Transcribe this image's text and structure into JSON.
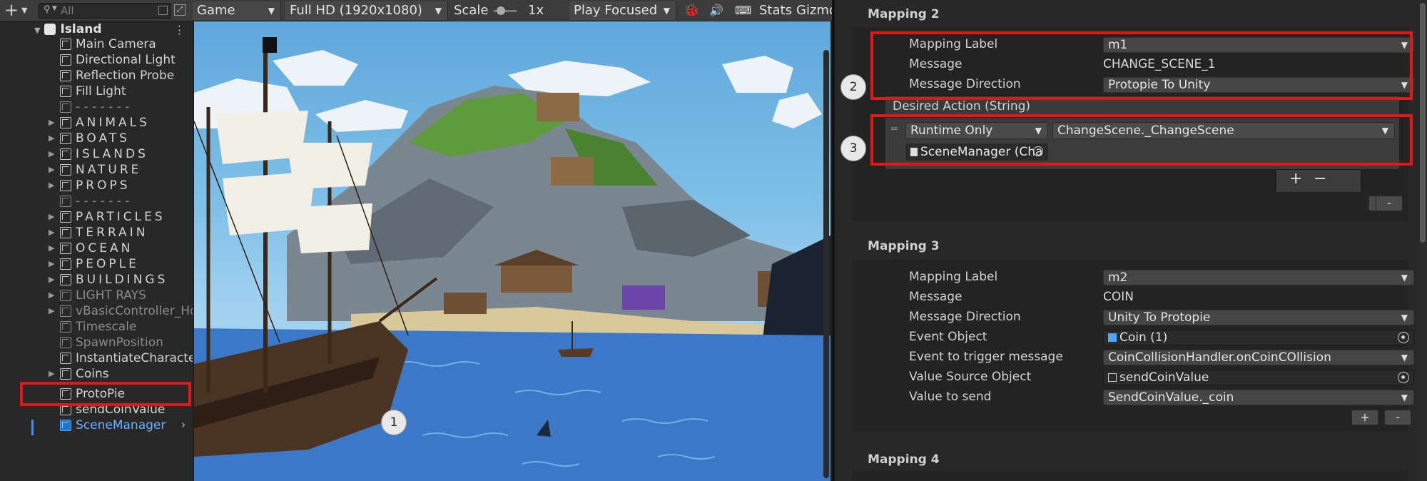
{
  "hierarchy": {
    "search_placeholder": "All",
    "scene_name": "Island",
    "items": [
      {
        "label": "Main Camera"
      },
      {
        "label": "Directional Light"
      },
      {
        "label": "Reflection Probe"
      },
      {
        "label": "Fill Light"
      },
      {
        "label": "- - - - - - -"
      },
      {
        "label": "ANIMALS"
      },
      {
        "label": "BOATS"
      },
      {
        "label": "ISLANDS"
      },
      {
        "label": "NATURE"
      },
      {
        "label": "PROPS"
      },
      {
        "label": "- - - - - - -"
      },
      {
        "label": "PARTICLES"
      },
      {
        "label": "TERRAIN"
      },
      {
        "label": "OCEAN"
      },
      {
        "label": "PEOPLE"
      },
      {
        "label": "BUILDINGS"
      },
      {
        "label": "LIGHT RAYS"
      },
      {
        "label": "vBasicController_Ho"
      },
      {
        "label": "Timescale"
      },
      {
        "label": "SpawnPosition"
      },
      {
        "label": "InstantiateCharacter"
      },
      {
        "label": "Coins"
      },
      {
        "label": "ProtoPie"
      },
      {
        "label": "sendCoinValue"
      },
      {
        "label": "SceneManager"
      }
    ]
  },
  "game": {
    "tab": "Game",
    "resolution": "Full HD (1920x1080)",
    "scale_label": "Scale",
    "scale_value": "1x",
    "play_mode": "Play Focused",
    "stats": "Stats",
    "gizmos": "Gizmo"
  },
  "annotations": {
    "badge1": "1",
    "badge2": "2",
    "badge3": "3"
  },
  "inspector": {
    "mapping2": {
      "title": "Mapping 2",
      "label_caption": "Mapping Label",
      "label_value": "m1",
      "message_caption": "Message",
      "message_value": "CHANGE_SCENE_1",
      "direction_caption": "Message Direction",
      "direction_value": "Protopie To Unity",
      "event_header": "Desired Action (String)",
      "runtime": "Runtime Only",
      "function": "ChangeScene._ChangeScene",
      "target": "SceneManager (Cha",
      "plus": "+",
      "minus": "−"
    },
    "mapping3": {
      "title": "Mapping 3",
      "label_caption": "Mapping Label",
      "label_value": "m2",
      "message_caption": "Message",
      "message_value": "COIN",
      "direction_caption": "Message Direction",
      "direction_value": "Unity To Protopie",
      "event_object_caption": "Event Object",
      "event_object_value": "Coin (1)",
      "trigger_caption": "Event to trigger message",
      "trigger_value": "CoinCollisionHandler.onCoinCOllision",
      "value_source_caption": "Value Source Object",
      "value_source_value": "sendCoinValue",
      "value_send_caption": "Value to send",
      "value_send_value": "SendCoinValue._coin",
      "plus": "+",
      "minus": "-"
    },
    "mapping4": {
      "title": "Mapping 4"
    },
    "add_plus": "+",
    "add_minus": "-"
  }
}
